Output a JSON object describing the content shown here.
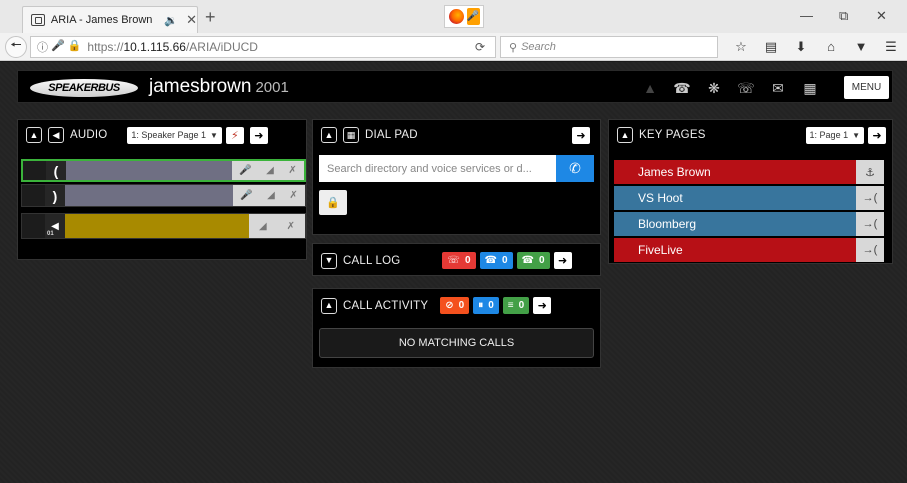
{
  "browser": {
    "tab_title": "ARIA - James Brown",
    "tab_audio_icon": "🔉",
    "tab_close": "✕",
    "new_tab": "+",
    "url_prefix": "https://",
    "url_host": "10.1.115.66",
    "url_path": "/ARIA/iDUCD",
    "search_placeholder": "Search",
    "window_controls": [
      "—",
      "⧉",
      "✕"
    ]
  },
  "app": {
    "logo_text": "SPEAKERBUS",
    "username": "jamesbrown",
    "extension": "2001",
    "menu_label": "MENU"
  },
  "audio": {
    "title": "AUDIO",
    "page_select": "1: Speaker Page 1",
    "channels": [
      {
        "glyph": "(",
        "color": "#6f6f83",
        "selected": true,
        "label": ""
      },
      {
        "glyph": ")",
        "color": "#6f6f83",
        "selected": false,
        "label": ""
      },
      {
        "glyph": "◀",
        "color": "#a88a00",
        "selected": false,
        "label": "01"
      }
    ]
  },
  "dialpad": {
    "title": "DIAL PAD",
    "search_placeholder": "Search directory and voice services or d..."
  },
  "call_log": {
    "title": "CALL LOG",
    "badges": [
      {
        "count": "0",
        "color": "#e53935",
        "icon": "missed-call-icon"
      },
      {
        "count": "0",
        "color": "#1e88e5",
        "icon": "incoming-call-icon"
      },
      {
        "count": "0",
        "color": "#43a047",
        "icon": "outgoing-call-icon"
      }
    ]
  },
  "call_activity": {
    "title": "CALL ACTIVITY",
    "badges": [
      {
        "count": "0",
        "color": "#f4511e",
        "icon": "blocked-icon"
      },
      {
        "count": "0",
        "color": "#1e88e5",
        "icon": "hold-icon"
      },
      {
        "count": "0",
        "color": "#43a047",
        "icon": "active-icon"
      }
    ],
    "empty_message": "NO MATCHING CALLS"
  },
  "key_pages": {
    "title": "KEY PAGES",
    "page_select": "1: Page 1",
    "keys": [
      {
        "name": "James Brown",
        "color": "red",
        "action": "⚓"
      },
      {
        "name": "VS Hoot",
        "color": "blue",
        "action": "→("
      },
      {
        "name": "Bloomberg",
        "color": "blue",
        "action": "→("
      },
      {
        "name": "FiveLive",
        "color": "red",
        "action": "→("
      }
    ]
  }
}
